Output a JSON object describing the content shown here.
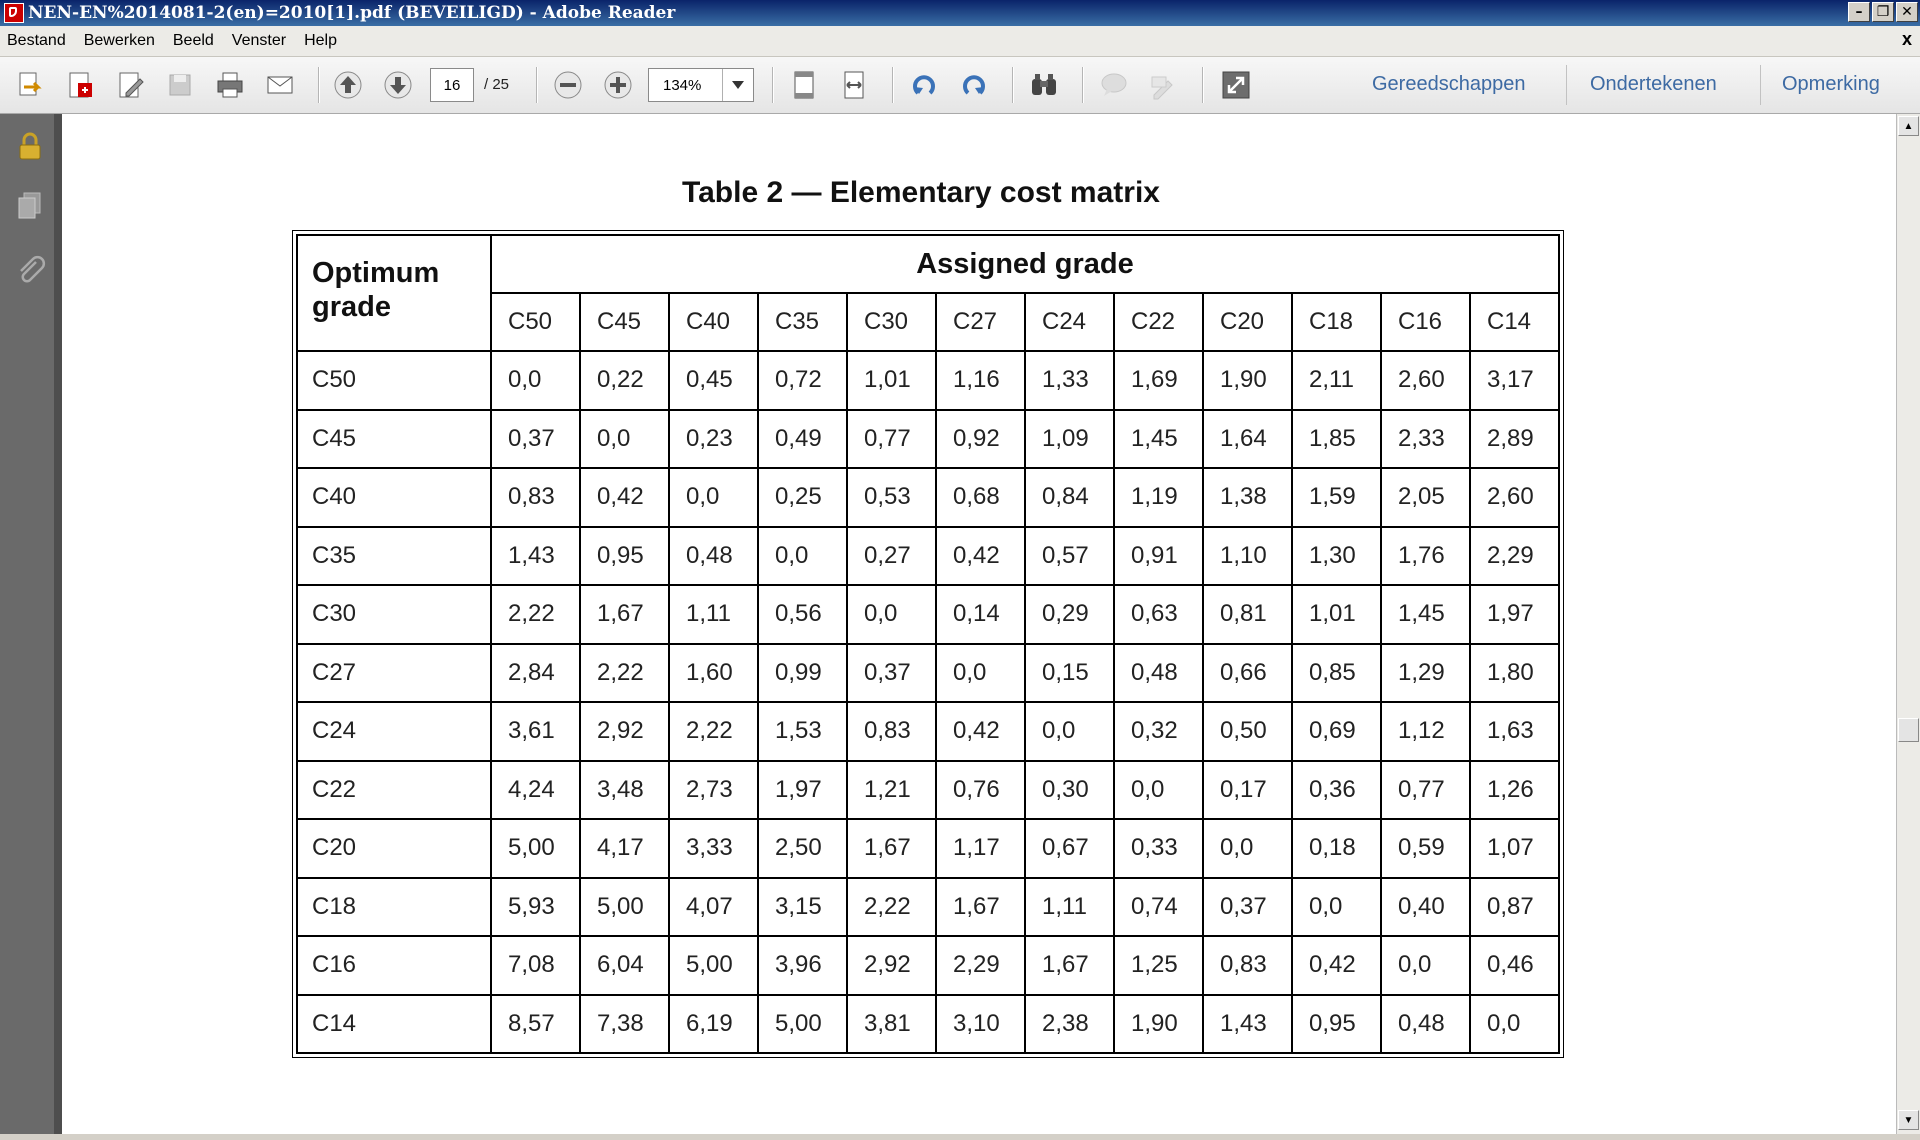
{
  "window": {
    "title": "NEN-EN%2014081-2(en)=2010[1].pdf (BEVEILIGD) - Adobe Reader",
    "app_icon": "adobe-pdf-icon",
    "controls": [
      "minimize",
      "restore",
      "close"
    ]
  },
  "menubar": {
    "items": [
      "Bestand",
      "Bewerken",
      "Beeld",
      "Venster",
      "Help"
    ],
    "close_glyph": "x"
  },
  "toolbar": {
    "current_page": "16",
    "page_total": "/ 25",
    "zoom": "134%",
    "links": [
      "Gereedschappen",
      "Ondertekenen",
      "Opmerking"
    ]
  },
  "document": {
    "table_title": "Table 2 — Elementary cost matrix",
    "row_header": "Optimum grade",
    "column_group_header": "Assigned grade",
    "columns": [
      "C50",
      "C45",
      "C40",
      "C35",
      "C30",
      "C27",
      "C24",
      "C22",
      "C20",
      "C18",
      "C16",
      "C14"
    ],
    "rows": [
      {
        "label": "C50",
        "values": [
          "0,0",
          "0,22",
          "0,45",
          "0,72",
          "1,01",
          "1,16",
          "1,33",
          "1,69",
          "1,90",
          "2,11",
          "2,60",
          "3,17"
        ]
      },
      {
        "label": "C45",
        "values": [
          "0,37",
          "0,0",
          "0,23",
          "0,49",
          "0,77",
          "0,92",
          "1,09",
          "1,45",
          "1,64",
          "1,85",
          "2,33",
          "2,89"
        ]
      },
      {
        "label": "C40",
        "values": [
          "0,83",
          "0,42",
          "0,0",
          "0,25",
          "0,53",
          "0,68",
          "0,84",
          "1,19",
          "1,38",
          "1,59",
          "2,05",
          "2,60"
        ]
      },
      {
        "label": "C35",
        "values": [
          "1,43",
          "0,95",
          "0,48",
          "0,0",
          "0,27",
          "0,42",
          "0,57",
          "0,91",
          "1,10",
          "1,30",
          "1,76",
          "2,29"
        ]
      },
      {
        "label": "C30",
        "values": [
          "2,22",
          "1,67",
          "1,11",
          "0,56",
          "0,0",
          "0,14",
          "0,29",
          "0,63",
          "0,81",
          "1,01",
          "1,45",
          "1,97"
        ]
      },
      {
        "label": "C27",
        "values": [
          "2,84",
          "2,22",
          "1,60",
          "0,99",
          "0,37",
          "0,0",
          "0,15",
          "0,48",
          "0,66",
          "0,85",
          "1,29",
          "1,80"
        ]
      },
      {
        "label": "C24",
        "values": [
          "3,61",
          "2,92",
          "2,22",
          "1,53",
          "0,83",
          "0,42",
          "0,0",
          "0,32",
          "0,50",
          "0,69",
          "1,12",
          "1,63"
        ]
      },
      {
        "label": "C22",
        "values": [
          "4,24",
          "3,48",
          "2,73",
          "1,97",
          "1,21",
          "0,76",
          "0,30",
          "0,0",
          "0,17",
          "0,36",
          "0,77",
          "1,26"
        ]
      },
      {
        "label": "C20",
        "values": [
          "5,00",
          "4,17",
          "3,33",
          "2,50",
          "1,67",
          "1,17",
          "0,67",
          "0,33",
          "0,0",
          "0,18",
          "0,59",
          "1,07"
        ]
      },
      {
        "label": "C18",
        "values": [
          "5,93",
          "5,00",
          "4,07",
          "3,15",
          "2,22",
          "1,67",
          "1,11",
          "0,74",
          "0,37",
          "0,0",
          "0,40",
          "0,87"
        ]
      },
      {
        "label": "C16",
        "values": [
          "7,08",
          "6,04",
          "5,00",
          "3,96",
          "2,92",
          "2,29",
          "1,67",
          "1,25",
          "0,83",
          "0,42",
          "0,0",
          "0,46"
        ]
      },
      {
        "label": "C14",
        "values": [
          "8,57",
          "7,38",
          "6,19",
          "5,00",
          "3,81",
          "3,10",
          "2,38",
          "1,90",
          "1,43",
          "0,95",
          "0,48",
          "0,0"
        ]
      }
    ]
  },
  "colors": {
    "titlebar": "#0a246a",
    "toolbar_link": "#3d6aa3",
    "nav_panel": "#6a6a6a"
  }
}
